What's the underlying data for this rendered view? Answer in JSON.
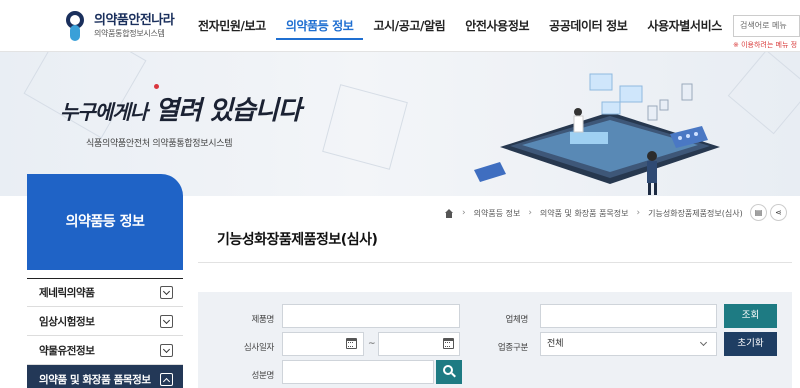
{
  "header": {
    "logo_main": "의약품안전나라",
    "logo_sub": "의약품통합정보시스템",
    "nav": [
      {
        "label": "전자민원/보고"
      },
      {
        "label": "의약품등 정보"
      },
      {
        "label": "고시/공고/알림"
      },
      {
        "label": "안전사용정보"
      },
      {
        "label": "공공데이터 정보"
      },
      {
        "label": "사용자별서비스"
      }
    ],
    "active_index": 1,
    "search_placeholder": "검색어로 메뉴",
    "search_note": "※ 이용하려는 메뉴 정"
  },
  "banner": {
    "slogan_part1": "누구에게나",
    "slogan_part2": "열려 있습니다",
    "subtitle": "식품의약품안전처 의약품통합정보시스템"
  },
  "sidebar": {
    "title": "의약품등 정보",
    "items": [
      {
        "label": "제네릭의약품",
        "expanded": false
      },
      {
        "label": "임상시험정보",
        "expanded": false
      },
      {
        "label": "약물유전정보",
        "expanded": false
      },
      {
        "label": "의약품 및 화장품 품목정보",
        "expanded": true
      }
    ]
  },
  "breadcrumb": [
    "의약품등 정보",
    "의약품 및 화장품 품목정보",
    "기능성화장품제품정보(심사)"
  ],
  "page_title": "기능성화장품제품정보(심사)",
  "form": {
    "product_name_label": "제품명",
    "product_name_value": "",
    "company_label": "업체명",
    "company_value": "",
    "review_date_label": "심사일자",
    "date_from": "",
    "date_separator": "~",
    "date_to": "",
    "business_type_label": "업종구분",
    "business_type_value": "전체",
    "ingredient_label": "성분명",
    "ingredient_value": "",
    "search_button": "조회",
    "reset_button": "초기화"
  },
  "colors": {
    "brand_blue": "#1f63c6",
    "active_nav": "#1f6fd1",
    "button_teal": "#1e7b83",
    "button_navy": "#1f3e63",
    "sidebar_active": "#233857"
  }
}
